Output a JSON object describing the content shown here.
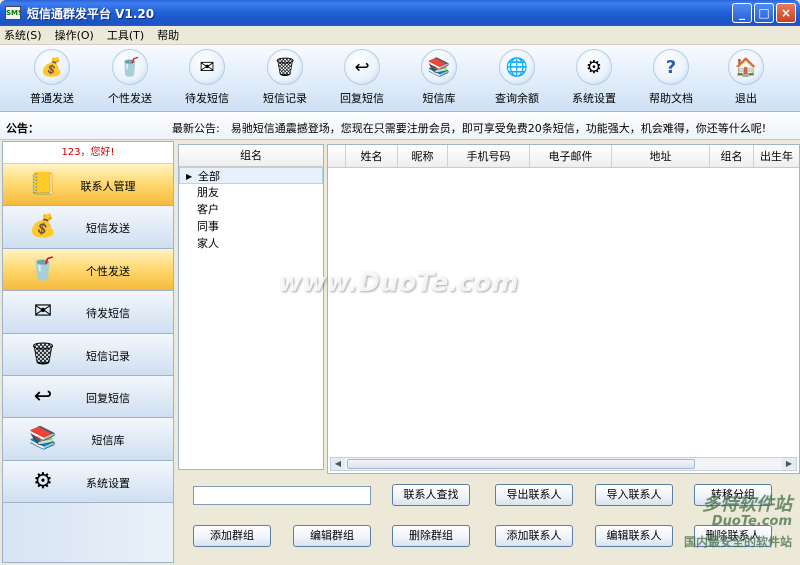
{
  "window": {
    "title": "短信通群发平台 V1.20",
    "icon_text": "SMS",
    "controls": [
      "_",
      "□",
      "×"
    ]
  },
  "menu": [
    "系统(S)",
    "操作(O)",
    "工具(T)",
    "帮助"
  ],
  "toolbar": [
    {
      "label": "普通发送",
      "icon": "coins-icon",
      "glyph": "💰"
    },
    {
      "label": "个性发送",
      "icon": "green-cup-icon",
      "glyph": "🥤"
    },
    {
      "label": "待发短信",
      "icon": "envelope-icon",
      "glyph": "✉"
    },
    {
      "label": "短信记录",
      "icon": "trash-can-icon",
      "glyph": "🗑"
    },
    {
      "label": "回复短信",
      "icon": "reply-icon",
      "glyph": "↩"
    },
    {
      "label": "短信库",
      "icon": "library-icon",
      "glyph": "📚"
    },
    {
      "label": "查询余额",
      "icon": "globe-icon",
      "glyph": "🌐"
    },
    {
      "label": "系统设置",
      "icon": "settings-icon",
      "glyph": "⚙"
    },
    {
      "label": "帮助文档",
      "icon": "help-icon",
      "glyph": "?"
    },
    {
      "label": "退出",
      "icon": "exit-icon",
      "glyph": "🏠"
    }
  ],
  "notice": {
    "label": "公告：",
    "latest": "最新公告:　易驰短信通震撼登场，您现在只需要注册会员，即可享受免费20条短信，功能强大，机会难得，你还等什么呢!"
  },
  "sidebar": {
    "greeting": "123，您好!",
    "items": [
      {
        "label": "联系人管理",
        "icon": "contacts-book-icon",
        "glyph": "📒",
        "active": true
      },
      {
        "label": "短信发送",
        "icon": "coins-icon",
        "glyph": "💰",
        "active": false
      },
      {
        "label": "个性发送",
        "icon": "green-cup-icon",
        "glyph": "🥤",
        "active": true
      },
      {
        "label": "待发短信",
        "icon": "envelope-icon",
        "glyph": "✉",
        "active": false
      },
      {
        "label": "短信记录",
        "icon": "trash-can-icon",
        "glyph": "🗑",
        "active": false
      },
      {
        "label": "回复短信",
        "icon": "reply-icon",
        "glyph": "↩",
        "active": false
      },
      {
        "label": "短信库",
        "icon": "library-icon",
        "glyph": "📚",
        "active": false
      },
      {
        "label": "系统设置",
        "icon": "settings-icon",
        "glyph": "⚙",
        "active": false
      }
    ]
  },
  "groups": {
    "header": "组名",
    "items": [
      "全部",
      "朋友",
      "客户",
      "同事",
      "家人"
    ],
    "selected_index": 0
  },
  "grid": {
    "columns": [
      "",
      "姓名",
      "昵称",
      "手机号码",
      "电子邮件",
      "地址",
      "组名",
      "出生年"
    ],
    "rows": []
  },
  "search": {
    "value": "",
    "placeholder": ""
  },
  "buttons": {
    "find": "联系人查找",
    "export": "导出联系人",
    "import": "导入联系人",
    "move": "转移分组",
    "add_group": "添加群组",
    "edit_group": "编辑群组",
    "delete_group": "删除群组",
    "add_contact": "添加联系人",
    "edit_contact": "编辑联系人",
    "delete_contact": "删除联系人"
  },
  "watermarks": {
    "center": "www.DuoTe.com",
    "corner_brand": "多特软件站",
    "corner_site": "DuoTe.com",
    "corner_slogan": "国内最安全的软件站"
  }
}
